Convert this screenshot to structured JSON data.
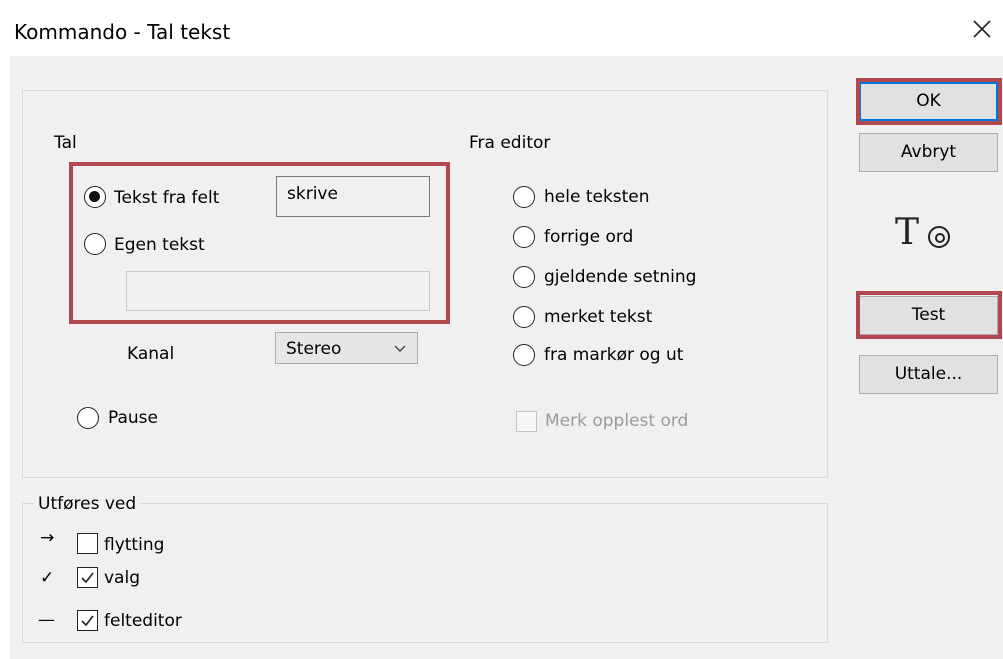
{
  "window": {
    "title": "Kommando - Tal tekst",
    "close_icon": "close-icon"
  },
  "tal_group": {
    "label": "Tal",
    "tekst_fra_felt_label": "Tekst fra felt",
    "tekst_fra_felt_value": "skrive",
    "egen_tekst_label": "Egen tekst",
    "egen_tekst_value": "",
    "kanal_label": "Kanal",
    "kanal_value": "Stereo",
    "pause_label": "Pause"
  },
  "fra_editor": {
    "label": "Fra editor",
    "options": [
      "hele teksten",
      "forrige ord",
      "gjeldende setning",
      "merket tekst",
      "fra markør og ut"
    ],
    "merk_opplest_label": "Merk opplest ord"
  },
  "utfores": {
    "label": "Utføres ved",
    "items": [
      {
        "icon": "→",
        "label": "flytting",
        "checked": false
      },
      {
        "icon": "✓",
        "label": "valg",
        "checked": true
      },
      {
        "icon": "—",
        "label": "felteditor",
        "checked": true
      }
    ]
  },
  "buttons": {
    "ok": "OK",
    "avbryt": "Avbryt",
    "test": "Test",
    "uttale": "Uttale..."
  },
  "colors": {
    "highlight": "#b2484f",
    "default_button_border": "#0078d7"
  }
}
